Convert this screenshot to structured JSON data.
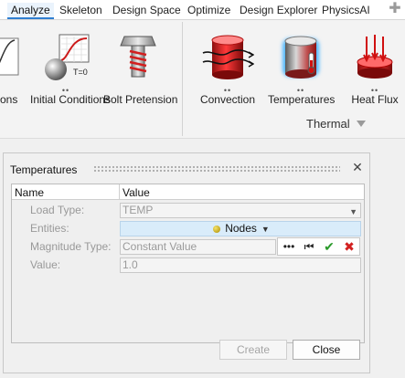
{
  "tabs": [
    {
      "label": "Analyze",
      "active": true
    },
    {
      "label": "Skeleton",
      "active": false
    },
    {
      "label": "Design Space",
      "active": false
    },
    {
      "label": "Optimize",
      "active": false
    },
    {
      "label": "Design Explorer",
      "active": false
    },
    {
      "label": "PhysicsAI",
      "active": false
    }
  ],
  "ribbon": {
    "tools": [
      {
        "label": "ons",
        "dots": "",
        "icon": "graph-icon"
      },
      {
        "label": "Initial Conditions",
        "dots": "••",
        "icon": "initial-conditions-icon",
        "icon_text": "T=0"
      },
      {
        "label": "Bolt Pretension",
        "dots": "",
        "icon": "bolt-icon"
      },
      {
        "label": "Convection",
        "dots": "••",
        "icon": "convection-icon"
      },
      {
        "label": "Temperatures",
        "dots": "••",
        "icon": "temperatures-icon"
      },
      {
        "label": "Heat Flux",
        "dots": "••",
        "icon": "heat-flux-icon"
      }
    ],
    "group_label": "Thermal"
  },
  "dialog": {
    "title": "Temperatures",
    "columns": {
      "name": "Name",
      "value": "Value"
    },
    "rows": {
      "load_type": {
        "label": "Load Type:",
        "value": "TEMP"
      },
      "entities": {
        "label": "Entities:",
        "value": "Nodes"
      },
      "magnitude_type": {
        "label": "Magnitude Type:",
        "value": "Constant Value"
      },
      "value": {
        "label": "Value:",
        "value": "1.0"
      }
    },
    "buttons": {
      "create": "Create",
      "close": "Close"
    }
  },
  "colors": {
    "accent": "#2f7fd1",
    "entities_bg": "#d9ecfa",
    "check": "#2a9a2a",
    "cross": "#d22020"
  }
}
